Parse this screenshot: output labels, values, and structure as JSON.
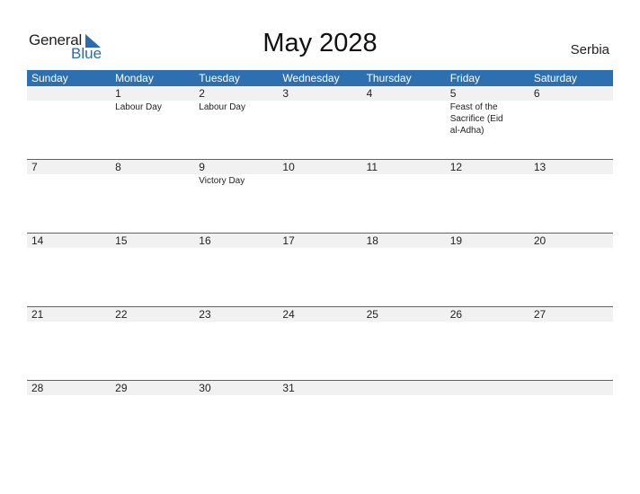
{
  "logo": {
    "general": "General",
    "blue": "Blue"
  },
  "title": "May 2028",
  "country": "Serbia",
  "colors": {
    "header": "#2e6fb0",
    "date_row": "#f1f1f1",
    "brand_blue": "#2b6cb0"
  },
  "days": [
    "Sunday",
    "Monday",
    "Tuesday",
    "Wednesday",
    "Thursday",
    "Friday",
    "Saturday"
  ],
  "weeks": [
    {
      "dates": [
        "",
        "1",
        "2",
        "3",
        "4",
        "5",
        "6"
      ],
      "events": [
        "",
        "Labour Day",
        "Labour Day",
        "",
        "",
        "Feast of the Sacrifice (Eid al-Adha)",
        ""
      ]
    },
    {
      "dates": [
        "7",
        "8",
        "9",
        "10",
        "11",
        "12",
        "13"
      ],
      "events": [
        "",
        "",
        "Victory Day",
        "",
        "",
        "",
        ""
      ]
    },
    {
      "dates": [
        "14",
        "15",
        "16",
        "17",
        "18",
        "19",
        "20"
      ],
      "events": [
        "",
        "",
        "",
        "",
        "",
        "",
        ""
      ]
    },
    {
      "dates": [
        "21",
        "22",
        "23",
        "24",
        "25",
        "26",
        "27"
      ],
      "events": [
        "",
        "",
        "",
        "",
        "",
        "",
        ""
      ]
    },
    {
      "dates": [
        "28",
        "29",
        "30",
        "31",
        "",
        "",
        ""
      ],
      "events": [
        "",
        "",
        "",
        "",
        "",
        "",
        ""
      ]
    }
  ]
}
